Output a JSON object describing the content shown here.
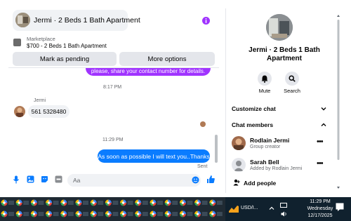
{
  "header": {
    "title": "Jermi · 2 Beds 1 Bath Apartment"
  },
  "marketplace": {
    "label": "Marketplace",
    "listing": "$700 - 2 Beds 1 Bath Apartment"
  },
  "actions": {
    "mark_pending": "Mark as pending",
    "more_options": "More options"
  },
  "messages": {
    "truncated_out": "please, share your contact number for details.",
    "time1": "8:17 PM",
    "sender_name": "Jermi",
    "incoming": "561 5328480",
    "time2": "11:29 PM",
    "outgoing": "As soon as possible I will text you..Thanks",
    "status": "Sent"
  },
  "composer": {
    "placeholder": "Aa"
  },
  "panel": {
    "title": "Jermi · 2 Beds 1 Bath Apartment",
    "mute_label": "Mute",
    "search_label": "Search",
    "customize": "Customize chat",
    "members_header": "Chat members",
    "members": [
      {
        "name": "Rodlain Jermi",
        "sub": "Group creator"
      },
      {
        "name": "Sarah Bell",
        "sub": "Added by Rodlain Jermi"
      }
    ],
    "add_people": "Add people"
  },
  "taskbar": {
    "ticker": "USD/I...",
    "time": "11:29 PM",
    "day": "Wednesday",
    "date": "12/17/2025"
  },
  "colors": {
    "accent_blue": "#0a7cff",
    "accent_purple": "#a033ff",
    "taskbar": "#1f2a33"
  }
}
